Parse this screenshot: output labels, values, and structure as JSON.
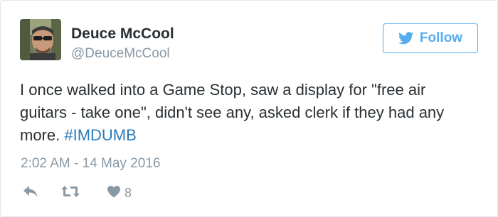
{
  "user": {
    "display_name": "Deuce McCool",
    "screen_name": "@DeuceMcCool"
  },
  "follow_button": {
    "label": "Follow"
  },
  "tweet": {
    "text": "I once walked into a Game Stop, saw a display for \"free air guitars - take one\", didn't see any, asked clerk if they had any more. ",
    "hashtag": "#IMDUMB",
    "timestamp": "2:02 AM - 14 May 2016"
  },
  "actions": {
    "like_count": "8"
  },
  "icons": {
    "follow": "twitter-bird-icon",
    "reply": "reply-arrow-icon",
    "retweet": "retweet-icon",
    "like": "heart-icon"
  },
  "colors": {
    "accent": "#55acee",
    "hashtag": "#2b7bb9",
    "text": "#292f33",
    "muted": "#8899a6",
    "border": "#e1e8ed"
  }
}
